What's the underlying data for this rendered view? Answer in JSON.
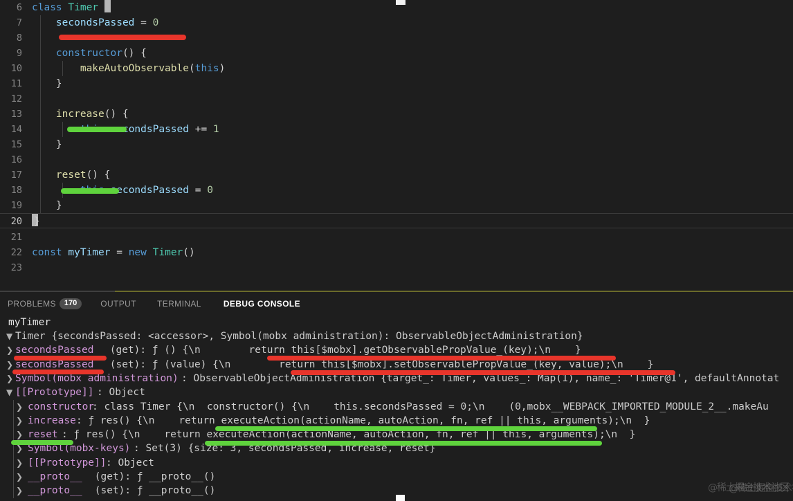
{
  "editor": {
    "language": "javascript",
    "first_line_number": 6,
    "active_line": 20,
    "lines": [
      {
        "n": "6",
        "text": "class Timer {"
      },
      {
        "n": "7",
        "text": "    secondsPassed = 0"
      },
      {
        "n": "8",
        "text": ""
      },
      {
        "n": "9",
        "text": "    constructor() {"
      },
      {
        "n": "10",
        "text": "        makeAutoObservable(this)"
      },
      {
        "n": "11",
        "text": "    }"
      },
      {
        "n": "12",
        "text": ""
      },
      {
        "n": "13",
        "text": "    increase() {"
      },
      {
        "n": "14",
        "text": "        this.secondsPassed += 1"
      },
      {
        "n": "15",
        "text": "    }"
      },
      {
        "n": "16",
        "text": ""
      },
      {
        "n": "17",
        "text": "    reset() {"
      },
      {
        "n": "18",
        "text": "        this.secondsPassed = 0"
      },
      {
        "n": "19",
        "text": "    }"
      },
      {
        "n": "20",
        "text": "}"
      },
      {
        "n": "21",
        "text": ""
      },
      {
        "n": "22",
        "text": "const myTimer = new Timer()"
      },
      {
        "n": "23",
        "text": ""
      }
    ],
    "annotations": [
      {
        "id": "red-underline-secondspassed-field",
        "color": "#e8352b",
        "target_line": "7"
      },
      {
        "id": "green-underline-increase",
        "color": "#5fd33d",
        "target_line": "13"
      },
      {
        "id": "green-underline-reset",
        "color": "#5fd33d",
        "target_line": "17"
      }
    ]
  },
  "panel": {
    "tabs": [
      {
        "label": "PROBLEMS",
        "badge": "170",
        "active": false
      },
      {
        "label": "OUTPUT",
        "badge": "",
        "active": false
      },
      {
        "label": "TERMINAL",
        "badge": "",
        "active": false
      },
      {
        "label": "DEBUG CONSOLE",
        "badge": "",
        "active": true
      }
    ],
    "console": {
      "input_echo": "myTimer",
      "lines": [
        {
          "arrow": "▼",
          "indent": 0,
          "text": "Timer {secondsPassed: <accessor>, Symbol(mobx administration): ObservableObjectAdministration}"
        },
        {
          "arrow": "❯",
          "indent": 0,
          "prop": "secondsPassed",
          "text": " (get): ƒ () {\\n        return this[$mobx].getObservablePropValue_(key);\\n    }"
        },
        {
          "arrow": "❯",
          "indent": 0,
          "prop": "secondsPassed",
          "text": " (set): ƒ (value) {\\n        return this[$mobx].setObservablePropValue_(key, value);\\n    }"
        },
        {
          "arrow": "❯",
          "indent": 0,
          "prop": "Symbol(mobx administration)",
          "text": ": ObservableObjectAdministration {target_: Timer, values_: Map(1), name_: 'Timer@1', defaultAnnotat"
        },
        {
          "arrow": "▼",
          "indent": 0,
          "prop": "[[Prototype]]",
          "text": ": Object"
        },
        {
          "arrow": "❯",
          "indent": 1,
          "prop": "constructor",
          "text": ": class Timer {\\n  constructor() {\\n    this.secondsPassed = 0;\\n    (0,mobx__WEBPACK_IMPORTED_MODULE_2__.makeAu"
        },
        {
          "arrow": "❯",
          "indent": 1,
          "prop": "increase",
          "text": ": ƒ res() {\\n    return executeAction(actionName, autoAction, fn, ref || this, arguments);\\n  }"
        },
        {
          "arrow": "❯",
          "indent": 1,
          "prop": "reset",
          "text": ": ƒ res() {\\n    return executeAction(actionName, autoAction, fn, ref || this, arguments);\\n  }"
        },
        {
          "arrow": "❯",
          "indent": 1,
          "prop": "Symbol(mobx-keys)",
          "text": ": Set(3) {size: 3, secondsPassed, increase, reset}"
        },
        {
          "arrow": "❯",
          "indent": 1,
          "prop": "[[Prototype]]",
          "text": ": Object"
        },
        {
          "arrow": "❯",
          "indent": 1,
          "prop": "__proto__",
          "text": " (get): ƒ __proto__()"
        },
        {
          "arrow": "❯",
          "indent": 1,
          "prop": "__proto__",
          "text": " (set): ƒ __proto__()"
        }
      ],
      "annotations": [
        {
          "id": "red-underline-get-prop",
          "color": "#e8352b"
        },
        {
          "id": "red-underline-get-body",
          "color": "#e8352b"
        },
        {
          "id": "red-underline-set-prop",
          "color": "#e8352b"
        },
        {
          "id": "red-underline-set-body",
          "color": "#e8352b"
        },
        {
          "id": "green-underline-increase-body",
          "color": "#5fd33d"
        },
        {
          "id": "green-underline-reset-prop",
          "color": "#5fd33d"
        },
        {
          "id": "green-underline-reset-body",
          "color": "#5fd33d"
        }
      ]
    }
  },
  "watermark": {
    "text": "@稀土掘金技术社区",
    "text2": "@稀土掘金技术社区"
  },
  "colors": {
    "background": "#1e1e1e",
    "keyword": "#569cd6",
    "type": "#4ec9b0",
    "function": "#dcdcaa",
    "property": "#9cdcfe",
    "number": "#b5cea8",
    "console_property": "#d197d9",
    "marker_red": "#e8352b",
    "marker_green": "#5fd33d",
    "panel_rule": "#6b6b2a"
  }
}
